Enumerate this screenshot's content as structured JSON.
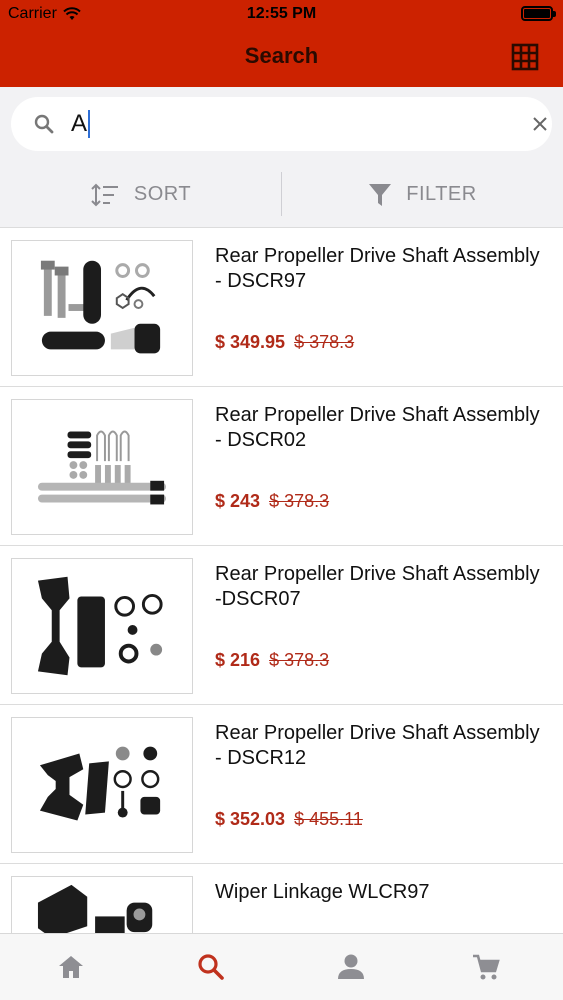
{
  "status_bar": {
    "carrier": "Carrier",
    "time": "12:55 PM"
  },
  "header": {
    "title": "Search",
    "grid_icon": "grid-icon",
    "background": "#cc2200"
  },
  "search": {
    "value": "A",
    "icon": "search-icon",
    "clear_icon": "close-icon"
  },
  "toolbar": {
    "sort_label": "SORT",
    "filter_label": "FILTER"
  },
  "products": [
    {
      "name": "Rear Propeller Drive Shaft Assembly - DSCR97",
      "price": "$ 349.95",
      "old_price": "$ 378.3"
    },
    {
      "name": "Rear Propeller Drive Shaft Assembly - DSCR02",
      "price": "$ 243",
      "old_price": "$ 378.3"
    },
    {
      "name": "Rear Propeller Drive Shaft Assembly -DSCR07",
      "price": "$ 216",
      "old_price": "$ 378.3"
    },
    {
      "name": "Rear Propeller Drive Shaft Assembly - DSCR12",
      "price": "$ 352.03",
      "old_price": "$ 455.11"
    },
    {
      "name": "Wiper Linkage WLCR97",
      "price": "",
      "old_price": ""
    }
  ],
  "tabbar": {
    "items": [
      {
        "icon": "home-icon",
        "active": false
      },
      {
        "icon": "search-icon",
        "active": true
      },
      {
        "icon": "user-icon",
        "active": false
      },
      {
        "icon": "cart-icon",
        "active": false
      }
    ],
    "active_color": "#c0321e",
    "inactive_color": "#8e8e93"
  }
}
